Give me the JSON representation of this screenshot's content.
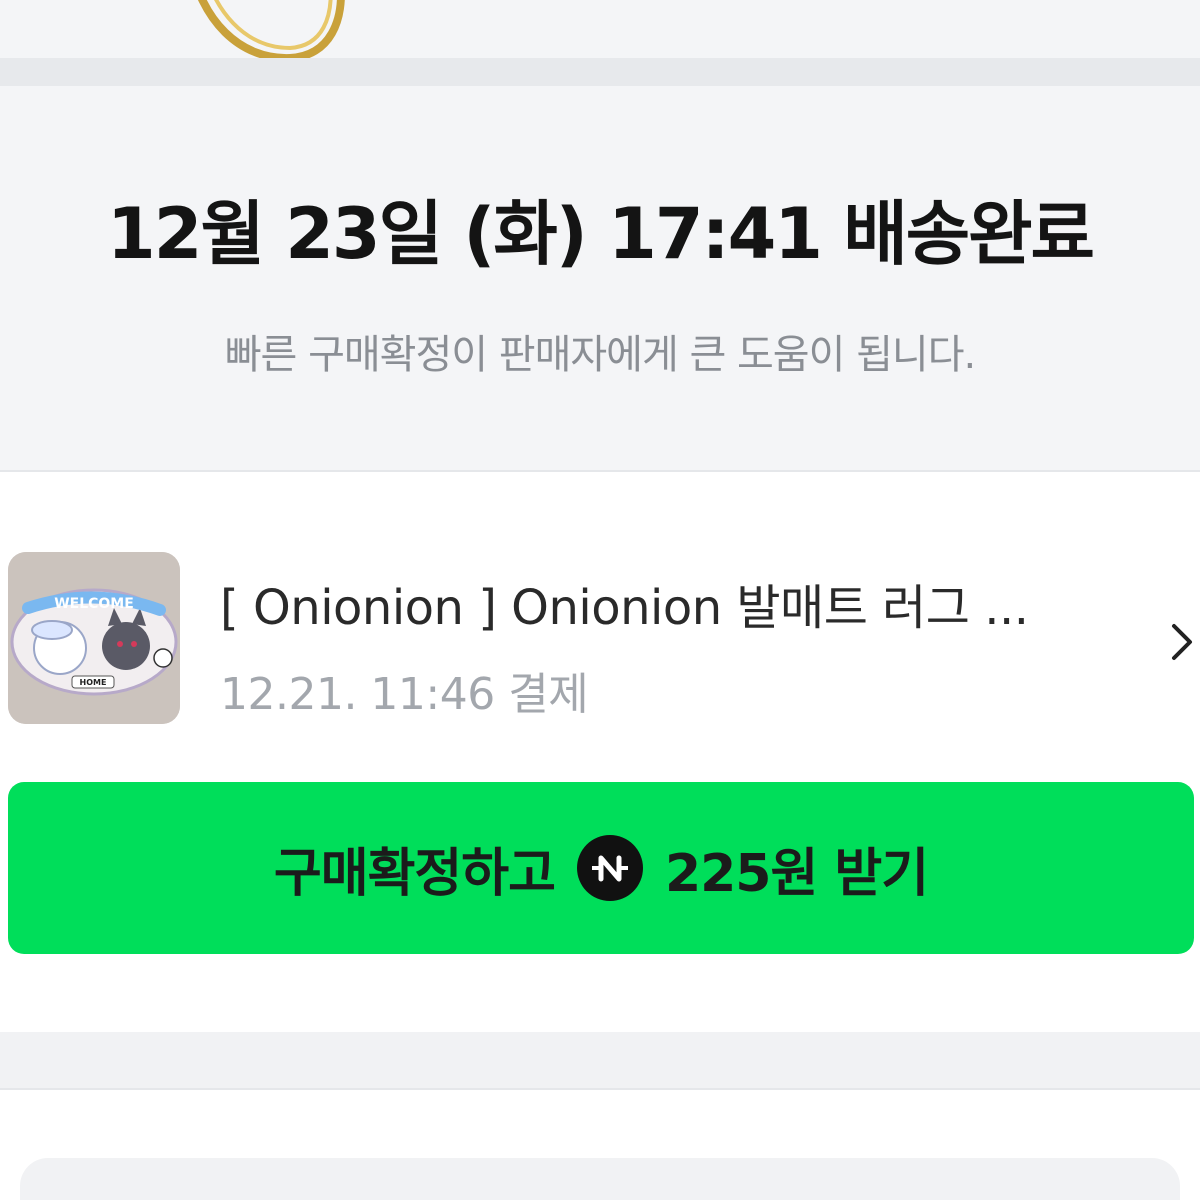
{
  "status": {
    "title": "12월 23일 (화) 17:41 배송완료",
    "subtitle": "빠른 구매확정이 판매자에게 큰 도움이 됩니다."
  },
  "order": {
    "product_name": "[ Onionion ] Onionion 발매트 러그 ...",
    "payment_info": "12.21. 11:46 결제"
  },
  "confirm_button": {
    "label_prefix": "구매확정하고",
    "point_icon": "npay-point-icon",
    "label_suffix": "225원 받기",
    "color": "#00de5a"
  },
  "thumbnail": {
    "sticker_text": "WELCOME",
    "badge_text": "HOME"
  }
}
